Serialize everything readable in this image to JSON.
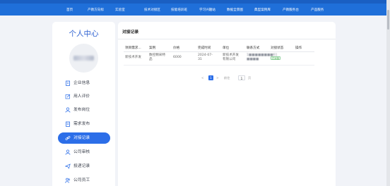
{
  "nav": {
    "items": [
      "首页",
      "产教方向标",
      "实验室",
      "技术对接区",
      "技能培训班",
      "学习兴趣站",
      "数据全景图",
      "典型案例库",
      "产教服务台",
      "产品服务"
    ]
  },
  "sidebar": {
    "title": "个人中心",
    "items": [
      {
        "label": "企业信息",
        "icon": "building-icon"
      },
      {
        "label": "用人评价",
        "icon": "edit-icon"
      },
      {
        "label": "发布岗位",
        "icon": "user-icon"
      },
      {
        "label": "需求发布",
        "icon": "document-icon"
      },
      {
        "label": "对接记录",
        "icon": "link-icon"
      },
      {
        "label": "公司审核",
        "icon": "user-check-icon"
      },
      {
        "label": "投递记录",
        "icon": "send-icon"
      },
      {
        "label": "公司员工",
        "icon": "users-icon"
      }
    ],
    "active_index": 4
  },
  "panel": {
    "title": "对接记录",
    "table": {
      "headers": [
        "项目需求...",
        "案例",
        "价格",
        "完成时间",
        "单位",
        "联系方式",
        "对接状态",
        "操作"
      ],
      "rows": [
        {
          "project": "新技术开发",
          "case_line1": "数控精采特",
          "case_line2": "品",
          "price": "6000",
          "date_line1": "2024-07-",
          "date_line2": "31",
          "unit_line1": "新技术开发",
          "unit_line2": "有限公司",
          "contact_line1": "1■■■■■■■■61",
          "contact_line2": "■■■■",
          "status": "已对接",
          "action": ""
        }
      ]
    },
    "pager": {
      "prev": "<",
      "current_page": "1",
      "next": ">",
      "goto_label": "前往",
      "goto_value": "1",
      "page_suffix": "页"
    }
  },
  "colors": {
    "nav_bg": "#1f6fd9",
    "accent": "#2c6ee8",
    "status_green": "#4caf50"
  }
}
